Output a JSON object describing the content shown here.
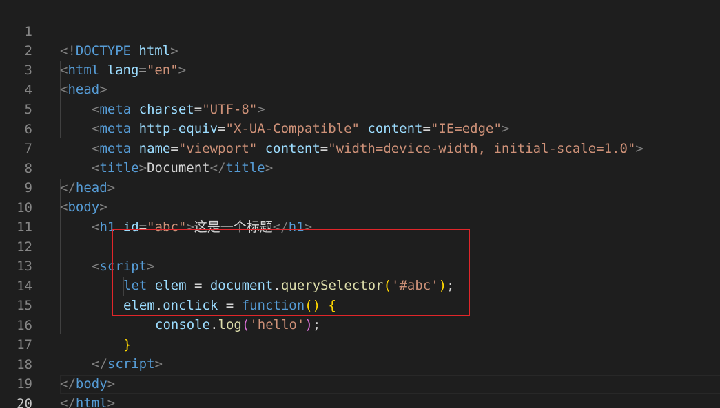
{
  "editor": {
    "active_line": "20",
    "lines": [
      {
        "n": "1",
        "t": [
          "<!",
          "DOCTYPE",
          " html",
          ">"
        ]
      },
      {
        "n": "2",
        "t": [
          "<",
          "html",
          " lang",
          "=",
          "\"en\"",
          ">"
        ]
      },
      {
        "n": "3",
        "t": [
          "<",
          "head",
          ">"
        ]
      },
      {
        "n": "4",
        "t": [
          "<",
          "meta",
          " charset",
          "=",
          "\"UTF-8\"",
          ">"
        ]
      },
      {
        "n": "5",
        "t": [
          "<",
          "meta",
          " http-equiv",
          "=",
          "\"X-UA-Compatible\"",
          " content",
          "=",
          "\"IE=edge\"",
          ">"
        ]
      },
      {
        "n": "6",
        "t": [
          "<",
          "meta",
          " name",
          "=",
          "\"viewport\"",
          " content",
          "=",
          "\"width=device-width, initial-scale=1.0\"",
          ">"
        ]
      },
      {
        "n": "7",
        "t": [
          "<",
          "title",
          ">",
          "Document",
          "</",
          "title",
          ">"
        ]
      },
      {
        "n": "8",
        "t": [
          "</",
          "head",
          ">"
        ]
      },
      {
        "n": "9",
        "t": [
          "<",
          "body",
          ">"
        ]
      },
      {
        "n": "10",
        "t": [
          "<",
          "h1",
          " id",
          "=",
          "\"abc\"",
          ">",
          "这是一个标题",
          "</",
          "h1",
          ">"
        ]
      },
      {
        "n": "11",
        "t": []
      },
      {
        "n": "12",
        "t": [
          "<",
          "script",
          ">"
        ]
      },
      {
        "n": "13",
        "t": [
          "let",
          " elem",
          " = ",
          "document",
          ".",
          "querySelector",
          "(",
          "'#abc'",
          ")",
          ";"
        ]
      },
      {
        "n": "14",
        "t": [
          "elem",
          ".",
          "onclick",
          " = ",
          "function",
          "()",
          " ",
          "{"
        ]
      },
      {
        "n": "15",
        "t": [
          "console",
          ".",
          "log",
          "(",
          "'hello'",
          ")",
          ";"
        ]
      },
      {
        "n": "16",
        "t": [
          "}"
        ]
      },
      {
        "n": "17",
        "t": [
          "</",
          "script",
          ">"
        ]
      },
      {
        "n": "18",
        "t": [
          "</",
          "body",
          ">"
        ]
      },
      {
        "n": "19",
        "t": [
          "</",
          "html",
          ">"
        ]
      },
      {
        "n": "20",
        "t": []
      }
    ]
  }
}
